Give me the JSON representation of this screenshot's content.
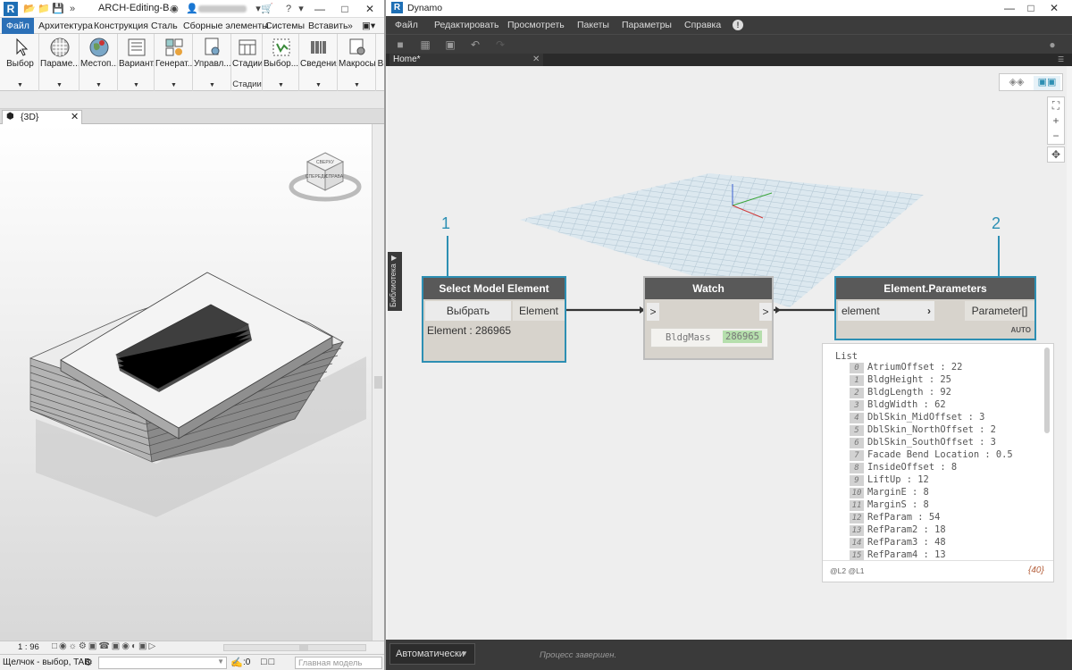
{
  "revit": {
    "doc_title": "ARCH-Editing-B...",
    "tabs": [
      {
        "label": "Файл",
        "active": true
      },
      {
        "label": "Архитектура"
      },
      {
        "label": "Конструкция"
      },
      {
        "label": "Сталь"
      },
      {
        "label": "Сборные элементы"
      },
      {
        "label": "Системы"
      },
      {
        "label": "Вставить"
      }
    ],
    "ribbon": [
      {
        "label": "Выбор"
      },
      {
        "label": "Параме..."
      },
      {
        "label": "Местоп..."
      },
      {
        "label": "Вариант..."
      },
      {
        "label": "Генерат..."
      },
      {
        "label": "Управл..."
      },
      {
        "label": "Стадии",
        "sub": "Стадии"
      },
      {
        "label": "Выбор..."
      },
      {
        "label": "Сведения"
      },
      {
        "label": "Макросы"
      },
      {
        "label": "В"
      }
    ],
    "view_tab": "{3D}",
    "scale": "1 : 96",
    "status": "Щелчок - выбор, TAB",
    "model_field": "Главная модель",
    "zero": ":0",
    "viewcube": {
      "top": "СВЕРХУ",
      "left": "СПЕРЕДИ",
      "right": "СПРАВА"
    }
  },
  "dynamo": {
    "title": "Dynamo",
    "menu": [
      "Файл",
      "Редактировать",
      "Просмотреть",
      "Пакеты",
      "Параметры",
      "Справка"
    ],
    "tab": "Home*",
    "library": "Библиотека",
    "run_mode": "Автоматически",
    "status": "Процесс завершен.",
    "callout1": "1",
    "callout2": "2",
    "node_select": {
      "title": "Select Model Element",
      "button": "Выбрать",
      "output": "Element",
      "value": "Element : 286965"
    },
    "node_watch": {
      "title": "Watch",
      "in": ">",
      "out": ">",
      "label": "BldgMass",
      "value": "286965"
    },
    "node_params": {
      "title": "Element.Parameters",
      "input": "element",
      "output": "Parameter[]",
      "lacing": "AUTO"
    },
    "watch_list": {
      "header": "List",
      "levels": "@L2 @L1",
      "count": "{40}",
      "items": [
        {
          "i": "0",
          "text": "AtriumOffset : 22"
        },
        {
          "i": "1",
          "text": "BldgHeight : 25"
        },
        {
          "i": "2",
          "text": "BldgLength : 92"
        },
        {
          "i": "3",
          "text": "BldgWidth : 62"
        },
        {
          "i": "4",
          "text": "DblSkin_MidOffset : 3"
        },
        {
          "i": "5",
          "text": "DblSkin_NorthOffset : 2"
        },
        {
          "i": "6",
          "text": "DblSkin_SouthOffset : 3"
        },
        {
          "i": "7",
          "text": "Facade Bend Location : 0.5"
        },
        {
          "i": "8",
          "text": "InsideOffset : 8"
        },
        {
          "i": "9",
          "text": "LiftUp : 12"
        },
        {
          "i": "10",
          "text": "MarginE : 8"
        },
        {
          "i": "11",
          "text": "MarginS : 8"
        },
        {
          "i": "12",
          "text": "RefParam : 54"
        },
        {
          "i": "13",
          "text": "RefParam2 : 18"
        },
        {
          "i": "14",
          "text": "RefParam3 : 48"
        },
        {
          "i": "15",
          "text": "RefParam4 : 13"
        }
      ]
    }
  }
}
